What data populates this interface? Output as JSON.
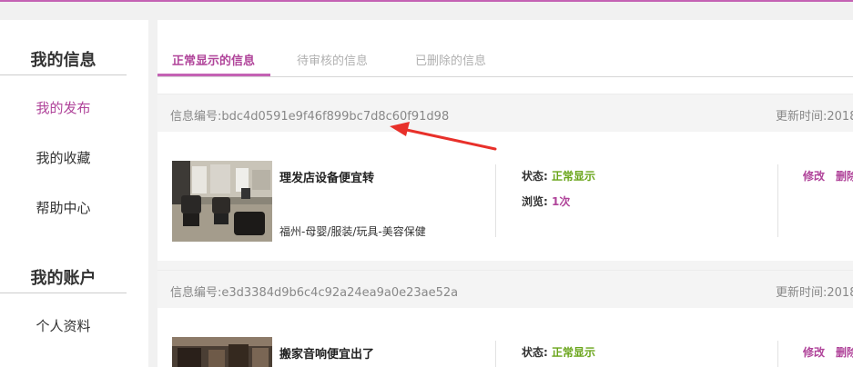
{
  "sidebar": {
    "section1_title": "我的信息",
    "items1": [
      {
        "label": "我的发布"
      },
      {
        "label": "我的收藏"
      },
      {
        "label": "帮助中心"
      }
    ],
    "section2_title": "我的账户",
    "items2": [
      {
        "label": "个人资料"
      }
    ]
  },
  "tabs": [
    {
      "label": "正常显示的信息"
    },
    {
      "label": "待审核的信息"
    },
    {
      "label": "已删除的信息"
    }
  ],
  "records": [
    {
      "id_text": "信息编号:bdc4d0591e9f46f899bc7d8c60f91d98",
      "time_text": "更新时间:2018",
      "title": "理发店设备便宜转",
      "category": "福州-母婴/服装/玩具-美容保健",
      "status_label": "状态:",
      "status_value": "正常显示",
      "views_label": "浏览:",
      "views_value": "1次",
      "edit_label": "修改",
      "delete_label": "删除"
    },
    {
      "id_text": "信息编号:e3d3384d9b6c4c92a24ea9a0e23ae52a",
      "time_text": "更新时间:2018",
      "title": "搬家音响便宜出了",
      "status_label": "状态:",
      "status_value": "正常显示",
      "edit_label": "修改",
      "delete_label": "删除"
    }
  ],
  "colors": {
    "accent": "#b0449a",
    "status_green": "#6aa51b"
  }
}
